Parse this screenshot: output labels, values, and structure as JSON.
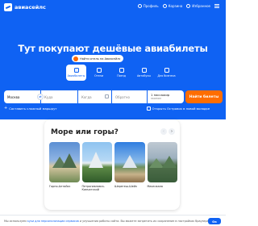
{
  "header": {
    "logo_text": "авиасейлс",
    "nav": [
      {
        "label": "Профиль",
        "icon": "user-icon"
      },
      {
        "label": "Корзина",
        "icon": "cart-icon"
      },
      {
        "label": "Избранное",
        "icon": "heart-icon"
      }
    ],
    "menu_icon": "burger-icon"
  },
  "hero": {
    "headline": "Тут покупают дешёвые авиабилеты",
    "promo_pill": "Найти отель на Авиасейлс",
    "tabs": [
      {
        "label": "Авиабилеты",
        "active": true
      },
      {
        "label": "Отели",
        "active": false
      },
      {
        "label": "Поезд",
        "active": false
      },
      {
        "label": "Автобусы",
        "active": false
      },
      {
        "label": "Для бизнеса",
        "active": false
      }
    ]
  },
  "search": {
    "origin": "Москва",
    "destination_placeholder": "Куда",
    "depart_placeholder": "Когда",
    "return_placeholder": "Обратно",
    "passengers_line1": "1 пассажир",
    "passengers_line2": "эконом",
    "submit_label": "Найти билеты",
    "complex_route_label": "Составить сложный маршрут",
    "booking_checkbox_label": "Открыть Островок в новой вкладке"
  },
  "card": {
    "title": "Море или горы?",
    "destinations": [
      {
        "name": "Горно-Алтайск"
      },
      {
        "name": "Петропавловск-Камчатский"
      },
      {
        "name": "Шерегеш-Шейх"
      },
      {
        "name": "Махачкала"
      }
    ]
  },
  "cookie_bar": {
    "text_before": "Мы используем",
    "link_text": "куки для персонализации сервисов",
    "text_after": "и улучшения работы сайта. Вы можете запретить их сохранение в настройках браузера.",
    "ok_label": "Ок"
  },
  "colors": {
    "brand_blue": "#0f62f3",
    "accent_orange": "#ff6d00"
  }
}
